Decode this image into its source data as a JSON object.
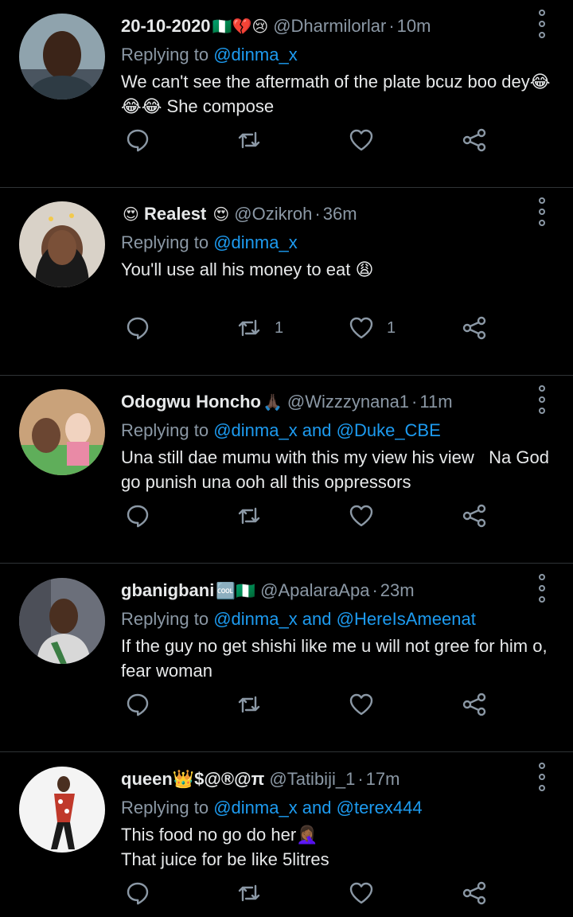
{
  "colors": {
    "background": "#000000",
    "text": "#e7e9ea",
    "muted": "#8b98a5",
    "link": "#1d9bf0",
    "divider": "#2f3336"
  },
  "icons": {
    "reply": "reply-icon",
    "retweet": "retweet-icon",
    "like": "heart-icon",
    "share": "share-icon",
    "more": "more-options-icon"
  },
  "tweets": [
    {
      "name": "20-10-2020",
      "emoji": "🇳🇬💔😢",
      "handle": "@Dharmilorlar",
      "dot": "·",
      "time": "10m",
      "replying_prefix": "Replying to",
      "replying_to": "@dinma_x",
      "text": "We can't see the aftermath of the plate bcuz boo dey😂😂😂 She compose",
      "retweets": "",
      "likes": ""
    },
    {
      "name": "Realest",
      "emoji_before": "😍",
      "emoji": "😍",
      "handle": "@Ozikroh",
      "dot": "·",
      "time": "36m",
      "replying_prefix": "Replying to",
      "replying_to": "@dinma_x",
      "text": "You'll use all his money to eat 😩",
      "retweets": "1",
      "likes": "1"
    },
    {
      "name": "Odogwu Honcho",
      "emoji": "🙏🏿",
      "handle": "@Wizzzynana1",
      "dot": "·",
      "time": "11m",
      "replying_prefix": "Replying to",
      "replying_to": "@dinma_x and @Duke_CBE",
      "text": "Una still dae mumu with this my view his view   Na God go punish una ooh all this oppressors",
      "retweets": "",
      "likes": ""
    },
    {
      "name": "gbanigbani",
      "emoji": "🆒🇳🇬",
      "handle": "@ApalaraApa",
      "dot": "·",
      "time": "23m",
      "replying_prefix": "Replying to",
      "replying_to": "@dinma_x and @HereIsAmeenat",
      "text": "If the guy no get shishi like me u will not gree for him o, fear woman",
      "retweets": "",
      "likes": ""
    },
    {
      "name": "queen👑$@®@π",
      "emoji": "",
      "handle": "@Tatibiji_1",
      "dot": "·",
      "time": "17m",
      "replying_prefix": "Replying to",
      "replying_to": "@dinma_x and @terex444",
      "text": "This food no go do her🤦🏾‍♀️\nThat juice for be like 5litres",
      "retweets": "",
      "likes": ""
    }
  ]
}
